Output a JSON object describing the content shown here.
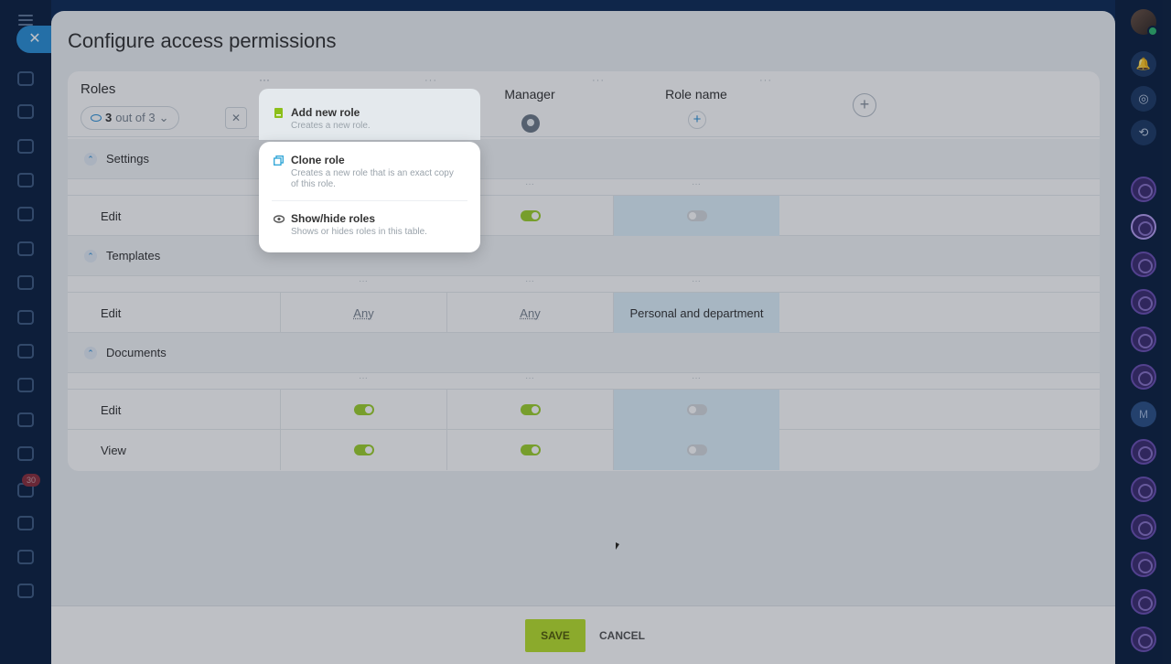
{
  "modal": {
    "title": "Configure access permissions",
    "close_glyph": "✕"
  },
  "roles_panel": {
    "label": "Roles",
    "filter_count": "3",
    "filter_suffix": "out of 3",
    "filter_chevron": "⌄",
    "collapse_glyph": "✕",
    "more_glyph": "···"
  },
  "columns": [
    {
      "title": "",
      "dots": "···"
    },
    {
      "title": "Manager",
      "dots": "···"
    },
    {
      "title": "Role name",
      "dots": "···"
    }
  ],
  "add_column_glyph": "+",
  "add_role_glyph": "+",
  "sections": [
    {
      "title": "Settings",
      "rows": [
        {
          "label": "Edit"
        }
      ]
    },
    {
      "title": "Templates",
      "rows": [
        {
          "label": "Edit"
        }
      ]
    },
    {
      "title": "Documents",
      "rows": [
        {
          "label": "Edit"
        },
        {
          "label": "View"
        }
      ]
    }
  ],
  "cells": {
    "templates_any_1": "Any",
    "templates_any_2": "Any",
    "templates_role": "Personal and department"
  },
  "section_chevron": "⌃",
  "menu": {
    "items": [
      {
        "title": "Add new role",
        "desc": "Creates a new role."
      },
      {
        "title": "Clone role",
        "desc": "Creates a new role that is an exact copy of this role."
      },
      {
        "title": "Show/hide roles",
        "desc": "Shows or hides roles in this table."
      }
    ]
  },
  "footer": {
    "save_label": "SAVE",
    "cancel_label": "CANCEL"
  },
  "left_badge": "30",
  "right_bar": {
    "letter": "M"
  },
  "colors": {
    "accent": "#2a8fd6",
    "toggle_on": "#9dd02b",
    "save_button": "#b9e12c",
    "highlight_column": "#dff1fb"
  }
}
